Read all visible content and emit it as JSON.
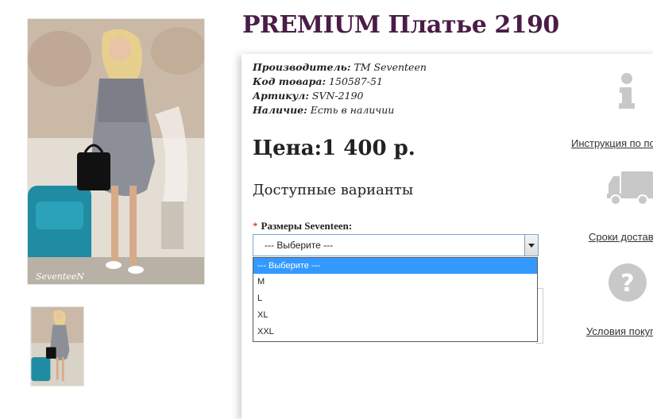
{
  "product": {
    "title": "PREMIUM Платье 2190",
    "meta": [
      {
        "key": "Производитель:",
        "value": " TM Seventeen"
      },
      {
        "key": "Код товара:",
        "value": " 150587-51"
      },
      {
        "key": "Артикул:",
        "value": " SVN-2190"
      },
      {
        "key": "Наличие:",
        "value": " Есть в наличии"
      }
    ],
    "price": "Цена:1 400 р.",
    "variants_heading": "Доступные варианты"
  },
  "size_select": {
    "required_mark": "*",
    "label": "Размеры Seventeen:",
    "value": "--- Выберите ---",
    "options": [
      "--- Выберите ---",
      "M",
      "L",
      "XL",
      "XXL"
    ]
  },
  "sidebar": {
    "links": [
      {
        "label": "Инструкция по по",
        "icon": "info-icon"
      },
      {
        "label": "Сроки достав",
        "icon": "truck-icon"
      },
      {
        "label": "Условия покуп",
        "icon": "question-icon"
      }
    ]
  },
  "images": {
    "watermark": "SeventeeN"
  },
  "colors": {
    "title": "#4a1c47",
    "option_highlight": "#3399ff",
    "select_border": "#7aa7d6",
    "icon_gray": "#c8c8c8"
  }
}
